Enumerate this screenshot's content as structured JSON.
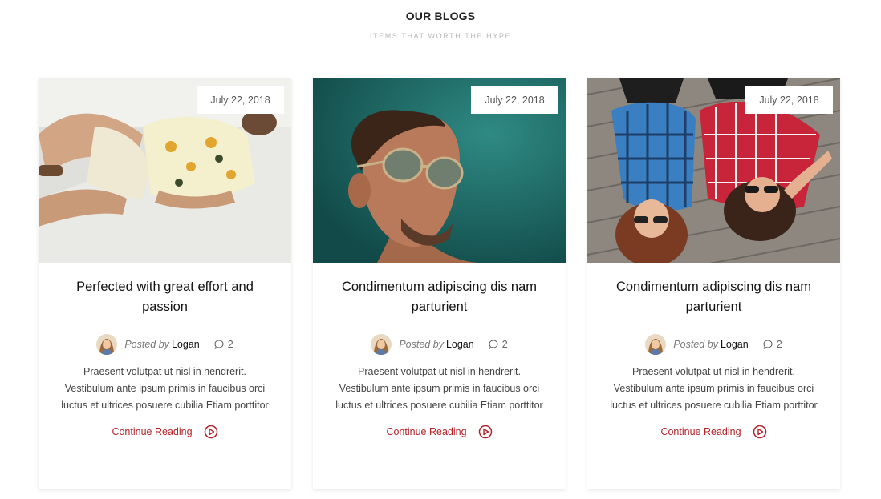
{
  "section": {
    "title": "OUR BLOGS",
    "subtitle": "ITEMS THAT WORTH THE HYPE"
  },
  "colors": {
    "accent": "#b3232a",
    "badge_bg": "#ffffff"
  },
  "posts": [
    {
      "date": "July 22, 2018",
      "title": "Perfected with great effort and passion",
      "posted_by_label": "Posted by",
      "author": "Logan",
      "comments": "2",
      "excerpt": "Praesent volutpat ut nisl in hendrerit. Vestibulum ante ipsum primis in faucibus orci luctus et ultrices posuere cubilia Etiam porttitor",
      "cta": "Continue Reading",
      "image_icon": "fashion-photo"
    },
    {
      "date": "July 22, 2018",
      "title": "Condimentum adipiscing dis nam parturient",
      "posted_by_label": "Posted by",
      "author": "Logan",
      "comments": "2",
      "excerpt": "Praesent volutpat ut nisl in hendrerit. Vestibulum ante ipsum primis in faucibus orci luctus et ultrices posuere cubilia Etiam porttitor",
      "cta": "Continue Reading",
      "image_icon": "portrait-photo"
    },
    {
      "date": "July 22, 2018",
      "title": "Condimentum adipiscing dis nam parturient",
      "posted_by_label": "Posted by",
      "author": "Logan",
      "comments": "2",
      "excerpt": "Praesent volutpat ut nisl in hendrerit. Vestibulum ante ipsum primis in faucibus orci luctus et ultrices posuere cubilia Etiam porttitor",
      "cta": "Continue Reading",
      "image_icon": "couple-photo"
    }
  ]
}
